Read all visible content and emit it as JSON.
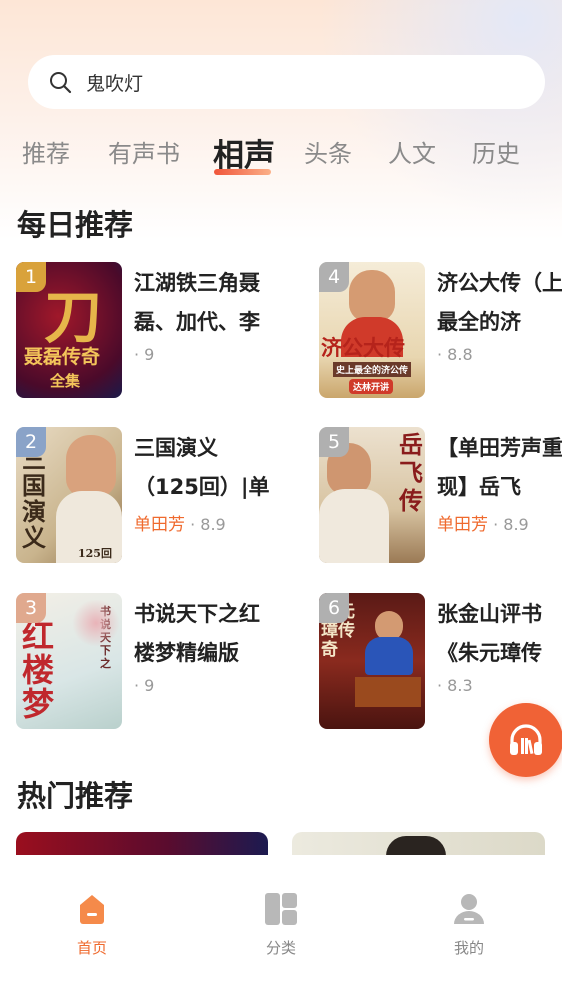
{
  "search": {
    "placeholder": "鬼吹灯"
  },
  "tabs": [
    {
      "label": "推荐"
    },
    {
      "label": "有声书"
    },
    {
      "label": "相声"
    },
    {
      "label": "头条"
    },
    {
      "label": "人文"
    },
    {
      "label": "历史"
    }
  ],
  "active_tab": "相声",
  "daily": {
    "title": "每日推荐",
    "items": [
      {
        "rank": "1",
        "title": "江湖铁三角聂磊、加代、李",
        "author": "",
        "score": "9",
        "cover_line1": "刀",
        "cover_line2": "聂磊传奇",
        "cover_line3": "全集",
        "rank_color": "#d9a23b"
      },
      {
        "rank": "2",
        "title": "三国演义（125回）|单",
        "author": "单田芳",
        "score": "8.9",
        "cover_line1": "三国演义",
        "cover_line2": "125回",
        "rank_color": "#8aa3c8"
      },
      {
        "rank": "3",
        "title": "书说天下之红楼梦精编版",
        "author": "",
        "score": "9",
        "cover_line1": "红楼梦",
        "cover_line2": "书说天下之",
        "rank_color": "#e0a98e"
      },
      {
        "rank": "4",
        "title": "济公大传（上最全的济",
        "author": "",
        "score": "8.8",
        "cover_line1": "济公大传",
        "cover_line2": "史上最全的济公传",
        "cover_line3": "达林开讲",
        "rank_color": "#b0b0b0"
      },
      {
        "rank": "5",
        "title": "【单田芳声重现】岳飞",
        "author": "单田芳",
        "score": "8.9",
        "cover_line1": "岳飞传",
        "rank_color": "#b0b0b0"
      },
      {
        "rank": "6",
        "title": "张金山评书《朱元璋传",
        "author": "",
        "score": "8.3",
        "cover_line1": "朱元璋传奇",
        "rank_color": "#b0b0b0"
      }
    ]
  },
  "hot": {
    "title": "热门推荐"
  },
  "bottom_nav": [
    {
      "label": "首页"
    },
    {
      "label": "分类"
    },
    {
      "label": "我的"
    }
  ],
  "colors": {
    "accent": "#ef6a2e",
    "float_button": "#f06236"
  },
  "icons": {
    "search": "search-icon",
    "float": "headphones-icon",
    "home": "home-icon",
    "category": "category-icon",
    "mine": "user-icon"
  }
}
